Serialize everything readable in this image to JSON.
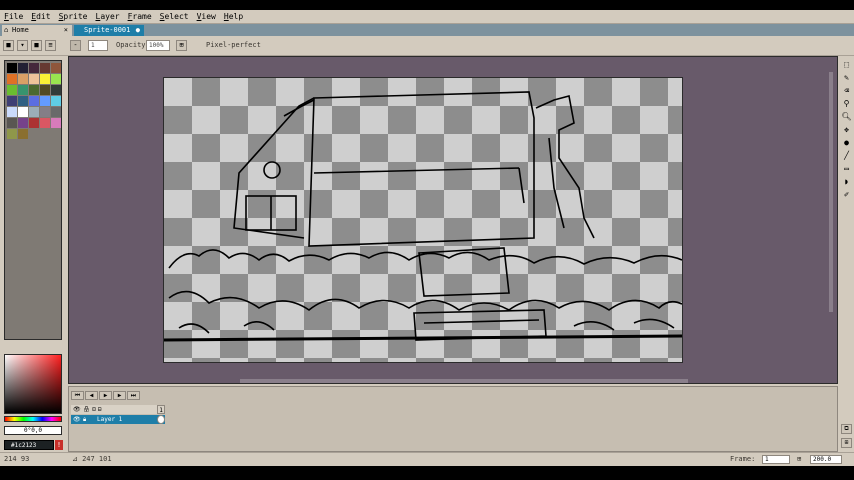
{
  "menu": [
    "File",
    "Edit",
    "Sprite",
    "Layer",
    "Frame",
    "Select",
    "View",
    "Help"
  ],
  "tabs": [
    {
      "label": "Home",
      "close": "×"
    },
    {
      "label": "Sprite-0001",
      "close": "●"
    }
  ],
  "toolbar": {
    "brush_size": "1",
    "opacity_label": "Opacity:",
    "opacity_value": "100%",
    "pixel_perfect_label": "Pixel-perfect"
  },
  "palette": {
    "swatches": [
      "#000000",
      "#222034",
      "#45283c",
      "#663931",
      "#8f563b",
      "#df7126",
      "#d9a066",
      "#eec39a",
      "#fbf236",
      "#99e550",
      "#6abe30",
      "#37946e",
      "#4b692f",
      "#524b24",
      "#323c39",
      "#3f3f74",
      "#306082",
      "#5b6ee1",
      "#639bff",
      "#5fcde4",
      "#cbdbfc",
      "#ffffff",
      "#9badb7",
      "#847e87",
      "#696a6a",
      "#595652",
      "#76428a",
      "#ac3232",
      "#d95763",
      "#d77bba",
      "#8f974a",
      "#8a6f30"
    ],
    "hsv_value": "0°0,0",
    "fg_color_hex": "#1c2123",
    "warning_icon": "!"
  },
  "timeline": {
    "controls": [
      "⏮",
      "◀",
      "▶",
      "▶",
      "⏭"
    ],
    "layer_name": "Layer 1",
    "frame_number": "1"
  },
  "status": {
    "cursor": "214  93",
    "selection": "⊿ 247 101",
    "frame_label": "Frame:",
    "frame_value": "1",
    "zoom": "200.0"
  }
}
